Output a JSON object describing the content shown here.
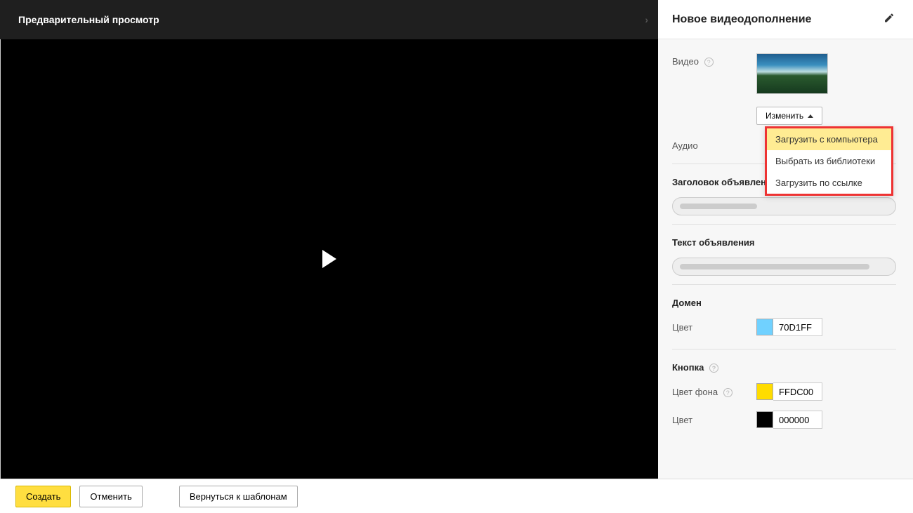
{
  "preview": {
    "title": "Предварительный просмотр"
  },
  "sidebar": {
    "title": "Новое видеодополнение",
    "video_label": "Видео",
    "audio_label": "Аудио",
    "change_btn": "Изменить",
    "dropdown": {
      "upload_computer": "Загрузить с компьютера",
      "choose_library": "Выбрать из библиотеки",
      "upload_link": "Загрузить по ссылке"
    },
    "ad_title_section": "Заголовок объявления",
    "ad_text_section": "Текст объявления",
    "domain_section": "Домен",
    "domain_color_label": "Цвет",
    "domain_color_value": "70D1FF",
    "domain_color_hex": "#70D1FF",
    "button_section": "Кнопка",
    "button_bg_label": "Цвет фона",
    "button_bg_value": "FFDC00",
    "button_bg_hex": "#FFDC00",
    "button_text_label": "Цвет",
    "button_text_value": "000000",
    "button_text_hex": "#000000"
  },
  "footer": {
    "create": "Создать",
    "cancel": "Отменить",
    "back": "Вернуться к шаблонам"
  }
}
